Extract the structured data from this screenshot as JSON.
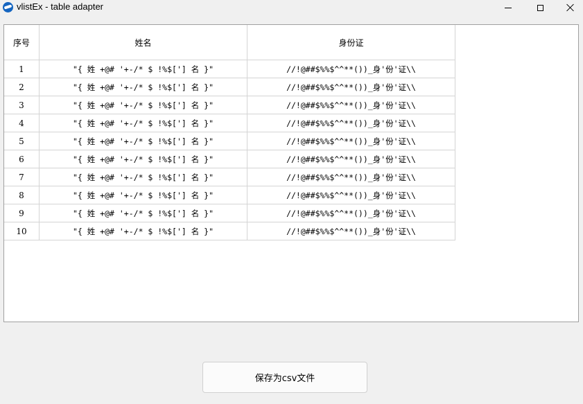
{
  "window": {
    "title": "vlistEx - table adapter",
    "controls": [
      "minimize-icon",
      "maximize-icon",
      "close-icon"
    ]
  },
  "table": {
    "columns": [
      "序号",
      "姓名",
      "身份证"
    ],
    "rows": [
      {
        "index": "1",
        "name": "\"{ 姓 +@# '+-/* $ !%$['] 名 }\"",
        "id": "//!@##$%%$^^**())_身'份'证\\\\"
      },
      {
        "index": "2",
        "name": "\"{ 姓 +@# '+-/* $ !%$['] 名 }\"",
        "id": "//!@##$%%$^^**())_身'份'证\\\\"
      },
      {
        "index": "3",
        "name": "\"{ 姓 +@# '+-/* $ !%$['] 名 }\"",
        "id": "//!@##$%%$^^**())_身'份'证\\\\"
      },
      {
        "index": "4",
        "name": "\"{ 姓 +@# '+-/* $ !%$['] 名 }\"",
        "id": "//!@##$%%$^^**())_身'份'证\\\\"
      },
      {
        "index": "5",
        "name": "\"{ 姓 +@# '+-/* $ !%$['] 名 }\"",
        "id": "//!@##$%%$^^**())_身'份'证\\\\"
      },
      {
        "index": "6",
        "name": "\"{ 姓 +@# '+-/* $ !%$['] 名 }\"",
        "id": "//!@##$%%$^^**())_身'份'证\\\\"
      },
      {
        "index": "7",
        "name": "\"{ 姓 +@# '+-/* $ !%$['] 名 }\"",
        "id": "//!@##$%%$^^**())_身'份'证\\\\"
      },
      {
        "index": "8",
        "name": "\"{ 姓 +@# '+-/* $ !%$['] 名 }\"",
        "id": "//!@##$%%$^^**())_身'份'证\\\\"
      },
      {
        "index": "9",
        "name": "\"{ 姓 +@# '+-/* $ !%$['] 名 }\"",
        "id": "//!@##$%%$^^**())_身'份'证\\\\"
      },
      {
        "index": "10",
        "name": "\"{ 姓 +@# '+-/* $ !%$['] 名 }\"",
        "id": "//!@##$%%$^^**())_身'份'证\\\\"
      }
    ]
  },
  "actions": {
    "save_label": "保存为csv文件"
  }
}
